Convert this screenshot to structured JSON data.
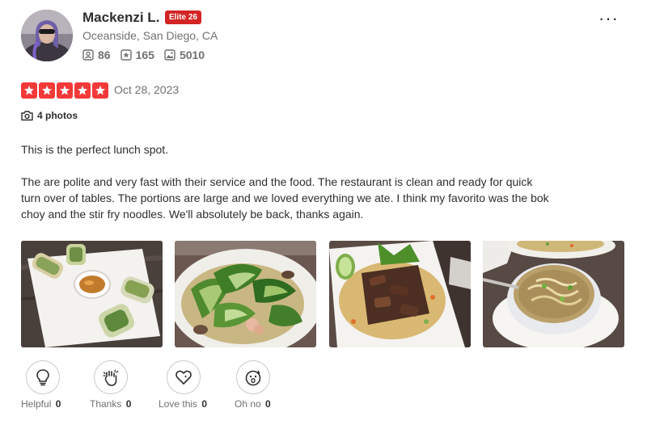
{
  "user": {
    "name": "Mackenzi L.",
    "elite_badge": "Elite 26",
    "location": "Oceanside, San Diego, CA",
    "friends": "86",
    "reviews": "165",
    "photos": "5010"
  },
  "review": {
    "rating": 5,
    "date": "Oct 28, 2023",
    "photos_label": "4 photos",
    "paragraph1": "This is the perfect lunch spot.",
    "paragraph2": "The are polite and very fast with their service and the food. The restaurant is clean and ready for quick turn over of tables. The portions are large and we loved everything we ate. I think my favorito was the bok choy and the stir fry noodles. We'll absolutely be back, thanks again."
  },
  "menu": {
    "more_label": "···"
  },
  "reactions": {
    "helpful": {
      "label": "Helpful",
      "count": "0"
    },
    "thanks": {
      "label": "Thanks",
      "count": "0"
    },
    "love": {
      "label": "Love this",
      "count": "0"
    },
    "ohno": {
      "label": "Oh no",
      "count": "0"
    }
  },
  "colors": {
    "star": "#f43939",
    "elite": "#d32323"
  },
  "icons": [
    "friends-icon",
    "review-star-icon",
    "photo-icon",
    "camera-icon",
    "lightbulb-icon",
    "clap-hands-icon",
    "heart-icon",
    "surprised-face-icon",
    "more-options-icon"
  ]
}
